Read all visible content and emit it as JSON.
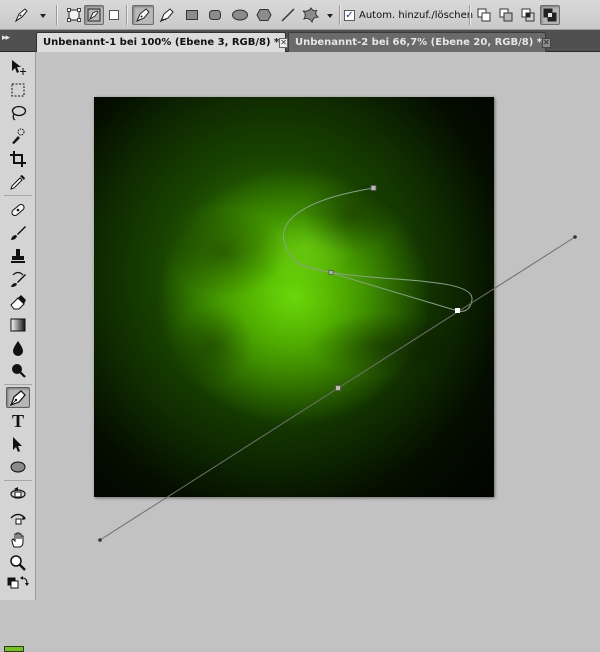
{
  "options": {
    "auto_add_delete_label": "Autom. hinzuf./löschen",
    "auto_add_delete_checked": true
  },
  "tabs": [
    {
      "label": "Unbenannt-1 bei 100% (Ebene 3, RGB/8) *",
      "active": true,
      "close_glyph": "✕"
    },
    {
      "label": "Unbenannt-2 bei 66,7% (Ebene 20, RGB/8) *",
      "active": false,
      "close_glyph": "✕"
    }
  ],
  "tools": [
    "move-tool-icon",
    "marquee-tool-icon",
    "lasso-tool-icon",
    "quick-selection-tool-icon",
    "crop-tool-icon",
    "eyedropper-tool-icon",
    "healing-brush-tool-icon",
    "brush-tool-icon",
    "clone-stamp-tool-icon",
    "history-brush-tool-icon",
    "eraser-tool-icon",
    "gradient-tool-icon",
    "blur-tool-icon",
    "dodge-tool-icon",
    "pen-tool-icon",
    "type-tool-icon",
    "path-selection-tool-icon",
    "ellipse-shape-tool-icon",
    "3d-rotate-tool-icon",
    "3d-orbit-tool-icon",
    "hand-tool-icon",
    "zoom-tool-icon"
  ],
  "active_tool": "pen-tool-icon",
  "type_tool_glyph": "T",
  "colors": {
    "foreground_swatch": "#6fc712",
    "canvas_glow": "#5fd000",
    "canvas_background": "#000000",
    "path_stroke": "#7a7a7a"
  }
}
